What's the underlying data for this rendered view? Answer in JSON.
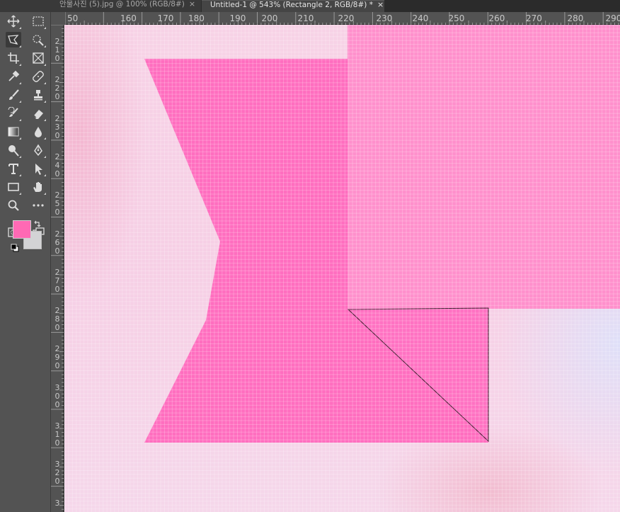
{
  "tabs": [
    {
      "label": "안물사진 (5).jpg @ 100% (RGB/8#)",
      "active": false
    },
    {
      "label": "Untitled-1 @ 543% (Rectangle 2, RGB/8#) *",
      "active": true
    }
  ],
  "tab_close_glyph": "×",
  "toolbar": {
    "tools": [
      {
        "icon": "move-icon"
      },
      {
        "icon": "rectangular-marquee-icon"
      },
      {
        "icon": "polygonal-lasso-icon",
        "active": true
      },
      {
        "icon": "quick-selection-icon"
      },
      {
        "icon": "crop-icon"
      },
      {
        "icon": "frame-icon"
      },
      {
        "icon": "eyedropper-icon"
      },
      {
        "icon": "healing-brush-icon"
      },
      {
        "icon": "brush-icon"
      },
      {
        "icon": "clone-stamp-icon"
      },
      {
        "icon": "history-brush-icon"
      },
      {
        "icon": "eraser-icon"
      },
      {
        "icon": "gradient-icon"
      },
      {
        "icon": "blur-icon"
      },
      {
        "icon": "dodge-icon"
      },
      {
        "icon": "pen-icon"
      },
      {
        "icon": "type-icon"
      },
      {
        "icon": "path-selection-icon"
      },
      {
        "icon": "rectangle-shape-icon"
      },
      {
        "icon": "hand-icon"
      },
      {
        "icon": "zoom-icon"
      },
      {
        "icon": "more-tools-icon"
      },
      {
        "icon": "quick-mask-icon"
      },
      {
        "icon": "screen-mode-icon"
      }
    ],
    "foreground_color": "#ff69b4",
    "background_color": "#d3d3d5"
  },
  "ruler": {
    "horizontal_labels": [
      "50",
      "160",
      "170",
      "180",
      "190",
      "200",
      "210",
      "220",
      "230",
      "240",
      "250",
      "260",
      "270",
      "280",
      "290"
    ],
    "vertical_labels": [
      "210",
      "220",
      "230",
      "240",
      "250",
      "260",
      "270",
      "280",
      "290",
      "300",
      "310",
      "320",
      "3"
    ]
  },
  "canvas": {
    "zoom_percent": 543,
    "shape_color": "#ff6ebf",
    "rect_color": "#ff90cc",
    "triangle_color": "#ff72c2"
  }
}
